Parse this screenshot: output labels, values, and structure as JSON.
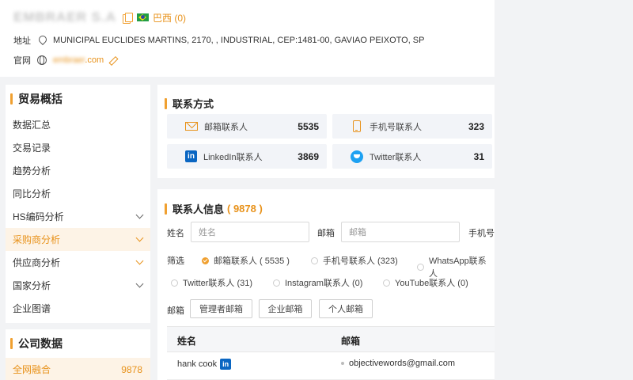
{
  "company": {
    "name": "EMBRAER S.A",
    "country": "巴西 (0)",
    "address_label": "地址",
    "address": "MUNICIPAL EUCLIDES MARTINS, 2170, , INDUSTRIAL, CEP:1481-00, GAVIAO PEIXOTO, SP",
    "website_label": "官网",
    "website_blurred": "embraer",
    "website_suffix": ".com"
  },
  "sidebar": {
    "section1_title": "贸易概括",
    "items": [
      {
        "label": "数据汇总"
      },
      {
        "label": "交易记录"
      },
      {
        "label": "趋势分析"
      },
      {
        "label": "同比分析"
      },
      {
        "label": "HS编码分析"
      },
      {
        "label": "采购商分析"
      },
      {
        "label": "供应商分析"
      },
      {
        "label": "国家分析"
      },
      {
        "label": "企业图谱"
      }
    ],
    "section2_title": "公司数据",
    "section2_items": [
      {
        "label": "全网融合",
        "count": "9878"
      }
    ]
  },
  "contact_methods": {
    "title": "联系方式",
    "items": [
      {
        "label": "邮箱联系人",
        "value": "5535",
        "icon": "mail-icon"
      },
      {
        "label": "手机号联系人",
        "value": "323",
        "icon": "phone-icon"
      },
      {
        "label": "LinkedIn联系人",
        "value": "3869",
        "icon": "linkedin-icon"
      },
      {
        "label": "Twitter联系人",
        "value": "31",
        "icon": "twitter-icon"
      }
    ]
  },
  "contacts": {
    "title": "联系人信息",
    "count": "( 9878 )",
    "name_label": "姓名",
    "name_placeholder": "姓名",
    "email_label": "邮箱",
    "email_placeholder": "邮箱",
    "phone_label": "手机号",
    "filter_label": "筛选",
    "filters": [
      {
        "label": "邮箱联系人 ( 5535 )",
        "checked": true
      },
      {
        "label": "手机号联系人 (323)",
        "checked": false
      },
      {
        "label": "WhatsApp联系人",
        "checked": false
      },
      {
        "label": "Twitter联系人 (31)",
        "checked": false
      },
      {
        "label": "Instagram联系人 (0)",
        "checked": false
      },
      {
        "label": "YouTube联系人 (0)",
        "checked": false
      }
    ],
    "mailbox_label": "邮箱",
    "mailbox_buttons": [
      "管理者邮箱",
      "企业邮箱",
      "个人邮箱"
    ],
    "table": {
      "headers": [
        "姓名",
        "邮箱"
      ],
      "rows": [
        {
          "name": "hank cook",
          "li": "in",
          "email": "objectivewords@gmail.com"
        }
      ]
    }
  },
  "colors": {
    "accent": "#f0a030",
    "accent_text": "#e8921a",
    "linkedin": "#0a66c2",
    "twitter": "#1da1f2"
  }
}
